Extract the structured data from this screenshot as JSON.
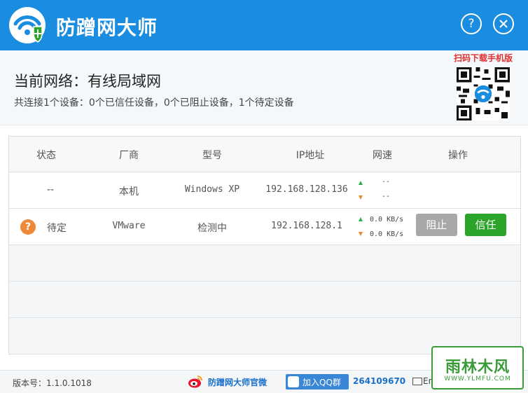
{
  "app": {
    "title": "防蹭网大师",
    "help_label": "?"
  },
  "network": {
    "title": "当前网络：有线局域网",
    "summary": "共连接1个设备：0个已信任设备，0个已阻止设备，1个待定设备"
  },
  "qr": {
    "label": "扫码下载手机版"
  },
  "table": {
    "headers": [
      "状态",
      "厂商",
      "型号",
      "IP地址",
      "网速",
      "操作"
    ],
    "rows": [
      {
        "status": "--",
        "vendor": "本机",
        "model": "Windows XP",
        "ip": "192.168.128.136",
        "up": "--",
        "down": "--"
      },
      {
        "status_icon": "?",
        "status": "待定",
        "vendor": "VMware",
        "model": "检测中",
        "ip": "192.168.128.1",
        "up": "0.0 KB/s",
        "down": "0.0 KB/s",
        "block_label": "阻止",
        "trust_label": "信任"
      }
    ]
  },
  "footer": {
    "version": "版本号：1.1.0.1018",
    "official": "防蹭网大师官微",
    "qq_label": "加入QQ群",
    "qq_number": "264109670",
    "email": "En"
  },
  "watermark": {
    "main": "雨林木风",
    "sub": "WWW.YLMFU.COM"
  },
  "colors": {
    "titlebar": "#1a8de0",
    "trust": "#2aa52a",
    "block": "#a8a8a8",
    "pending": "#f0883a"
  }
}
